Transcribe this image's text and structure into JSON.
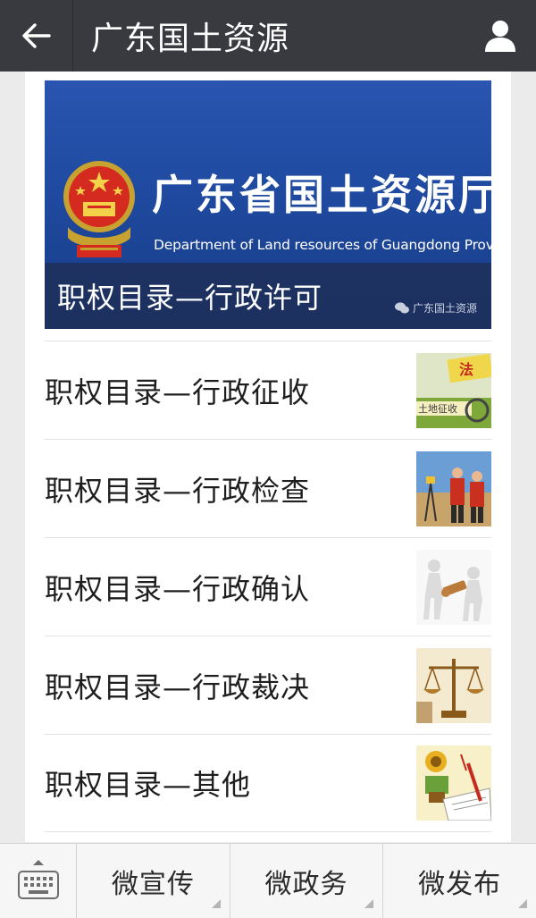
{
  "header": {
    "title": "广东国土资源",
    "back_icon": "arrow-left-icon",
    "profile_icon": "person-icon",
    "background": "#393a3f"
  },
  "banner": {
    "title_cn": "广东省国土资源厅",
    "title_en": "Department of Land resources of Guangdong Province",
    "caption": "职权目录—行政许可",
    "watermark": "广东国土资源",
    "background": "#1f4aa0"
  },
  "articles": [
    {
      "title": "职权目录—行政征收",
      "thumb_icon": "land-expropriation-thumbnail"
    },
    {
      "title": "职权目录—行政检查",
      "thumb_icon": "survey-workers-thumbnail"
    },
    {
      "title": "职权目录—行政确认",
      "thumb_icon": "handshake-figures-thumbnail"
    },
    {
      "title": "职权目录—行政裁决",
      "thumb_icon": "justice-scales-thumbnail"
    },
    {
      "title": "职权目录—其他",
      "thumb_icon": "document-signing-thumbnail"
    }
  ],
  "menu": {
    "keyboard_icon": "keyboard-icon",
    "items": [
      {
        "label": "微宣传"
      },
      {
        "label": "微政务"
      },
      {
        "label": "微发布"
      }
    ]
  }
}
